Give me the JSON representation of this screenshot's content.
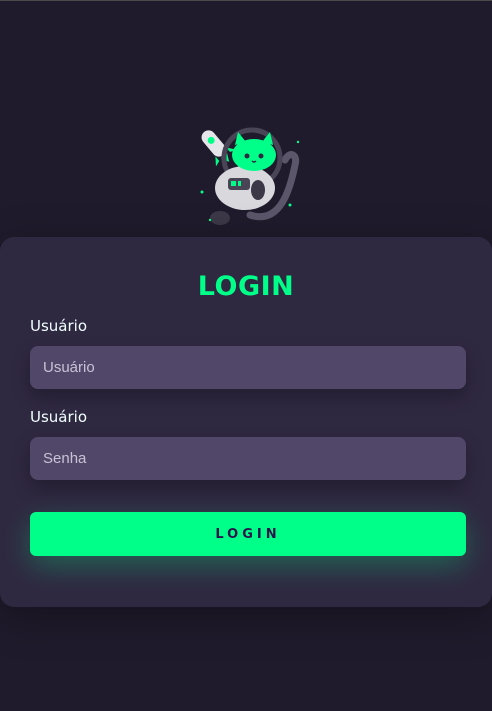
{
  "colors": {
    "background": "#201b2c",
    "card": "#2f2841",
    "accent": "#00ff88",
    "input_bg": "#514869",
    "text": "#f0ffff"
  },
  "mascot": {
    "icon": "astronaut-cat-illustration"
  },
  "login": {
    "title": "LOGIN",
    "username_label": "Usuário",
    "username_placeholder": "Usuário",
    "password_label": "Usuário",
    "password_placeholder": "Senha",
    "submit_label": "LOGIN"
  }
}
